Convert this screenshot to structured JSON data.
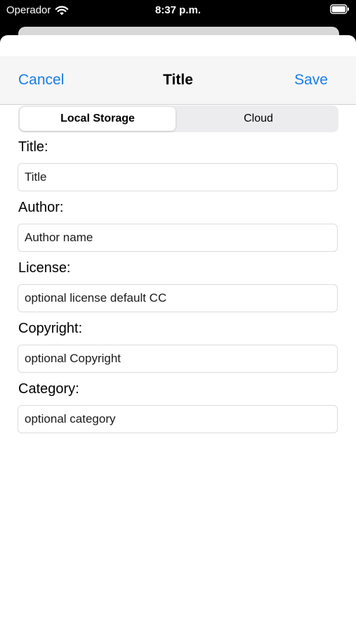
{
  "status_bar": {
    "carrier": "Operador",
    "time": "8:37 p.m.",
    "wifi_icon": "wifi-icon",
    "battery_icon": "battery-icon"
  },
  "nav": {
    "cancel_label": "Cancel",
    "title": "Title",
    "save_label": "Save",
    "accent_color": "#1a7ce8"
  },
  "storage_selector": {
    "options": [
      "Local Storage",
      "Cloud"
    ],
    "selected": "Local Storage"
  },
  "form": {
    "fields": [
      {
        "label": "Title:",
        "placeholder": "Title"
      },
      {
        "label": "Author:",
        "placeholder": "Author name"
      },
      {
        "label": "License:",
        "placeholder": "optional license default CC"
      },
      {
        "label": "Copyright:",
        "placeholder": "optional Copyright"
      },
      {
        "label": "Category:",
        "placeholder": "optional category"
      }
    ]
  }
}
